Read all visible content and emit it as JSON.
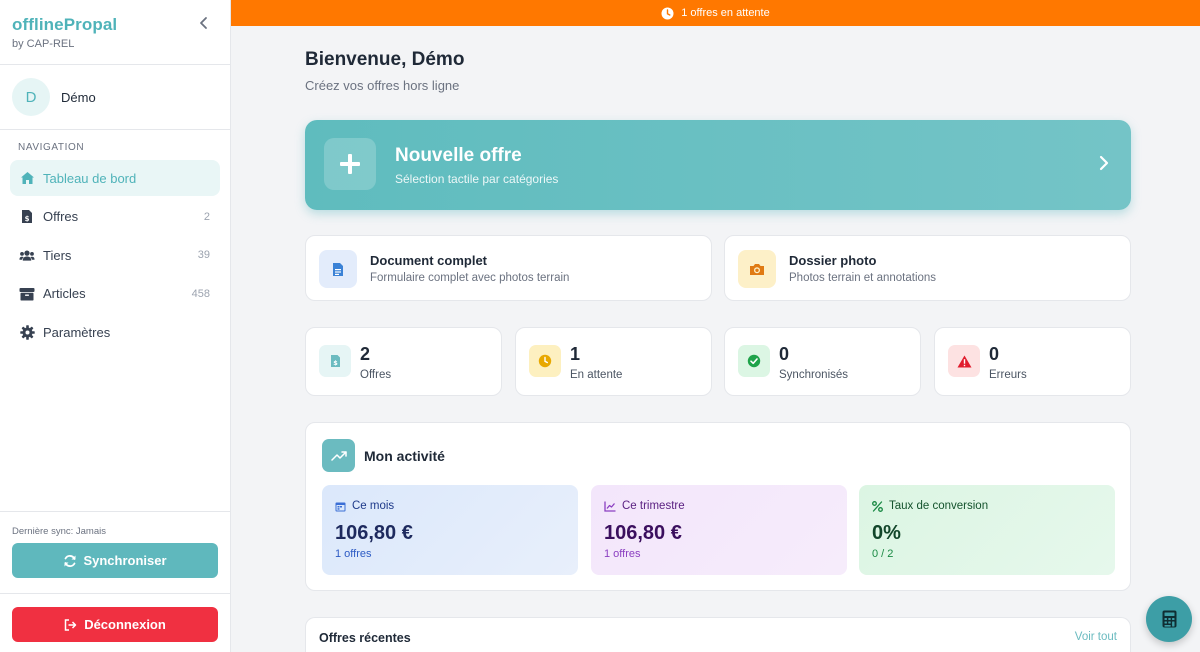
{
  "brand": {
    "name": "offlinePropal",
    "sub": "by CAP-REL"
  },
  "user": {
    "initial": "D",
    "name": "Démo"
  },
  "nav": {
    "title": "NAVIGATION",
    "items": [
      {
        "label": "Tableau de bord",
        "count": "",
        "icon": "home-icon",
        "active": true
      },
      {
        "label": "Offres",
        "count": "2",
        "icon": "invoice-icon"
      },
      {
        "label": "Tiers",
        "count": "39",
        "icon": "users-icon"
      },
      {
        "label": "Articles",
        "count": "458",
        "icon": "box-icon"
      },
      {
        "label": "Paramètres",
        "count": "",
        "icon": "gear-icon"
      }
    ]
  },
  "sync": {
    "label": "Dernière sync: Jamais",
    "button": "Synchroniser"
  },
  "logout": {
    "button": "Déconnexion"
  },
  "banner": {
    "text": "1 offres en attente",
    "color": "#ff7800"
  },
  "main": {
    "welcome": "Bienvenue, Démo",
    "subtitle": "Créez vos offres hors ligne",
    "hero": {
      "title": "Nouvelle offre",
      "sub": "Sélection tactile par catégories"
    },
    "docs": [
      {
        "title": "Document complet",
        "sub": "Formulaire complet avec photos terrain",
        "icon": "document-icon"
      },
      {
        "title": "Dossier photo",
        "sub": "Photos terrain et annotations",
        "icon": "camera-icon"
      }
    ],
    "stats": [
      {
        "value": "2",
        "label": "Offres",
        "icon": "invoice-icon"
      },
      {
        "value": "1",
        "label": "En attente",
        "icon": "clock-icon"
      },
      {
        "value": "0",
        "label": "Synchronisés",
        "icon": "check-icon"
      },
      {
        "value": "0",
        "label": "Erreurs",
        "icon": "warning-icon"
      }
    ],
    "activity": {
      "title": "Mon activité",
      "boxes": [
        {
          "head": "Ce mois",
          "value": "106,80 €",
          "sub": "1 offres",
          "icon": "calendar-icon"
        },
        {
          "head": "Ce trimestre",
          "value": "106,80 €",
          "sub": "1 offres",
          "icon": "chart-icon"
        },
        {
          "head": "Taux de conversion",
          "value": "0%",
          "sub": "0 / 2",
          "icon": "percent-icon"
        }
      ]
    },
    "recent": {
      "title": "Offres récentes",
      "link": "Voir tout"
    }
  },
  "fab": {
    "icon": "calculator-icon"
  }
}
